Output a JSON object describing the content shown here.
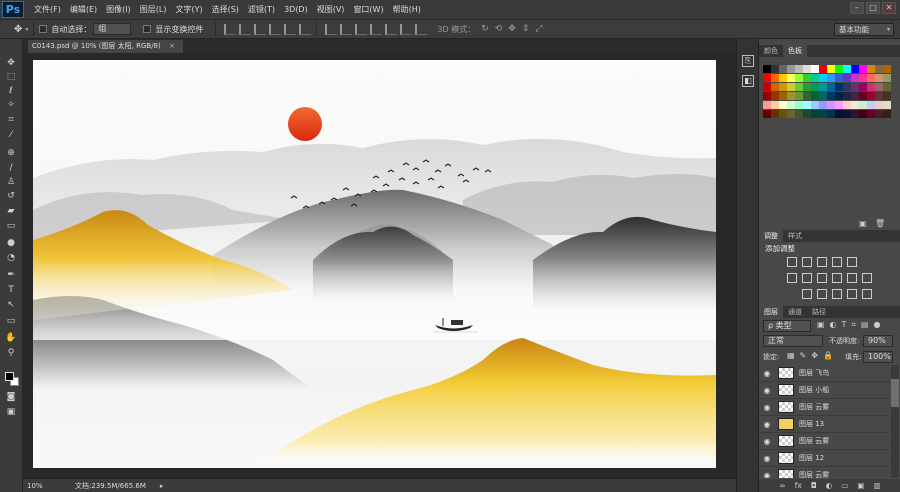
{
  "app": {
    "logo": "Ps"
  },
  "menu": [
    "文件(F)",
    "编辑(E)",
    "图像(I)",
    "图层(L)",
    "文字(Y)",
    "选择(S)",
    "滤镜(T)",
    "3D(D)",
    "视图(V)",
    "窗口(W)",
    "帮助(H)"
  ],
  "window_controls": [
    "–",
    "□",
    "✕"
  ],
  "options": {
    "auto_select_label": "自动选择：",
    "auto_select_value": "组",
    "show_transform_label": "显示变换控件",
    "mode_3d_label": "3D 模式：",
    "workspace": "基本功能"
  },
  "document_tab": {
    "label": "C0143.psd @ 10% (图层 太阳, RGB/8)",
    "close": "×"
  },
  "status": {
    "zoom": "10%",
    "doc_size": "文档:239.5M/665.6M",
    "arrow": "▸"
  },
  "panels": {
    "color": {
      "tabs": [
        "颜色",
        "色板"
      ],
      "active": 1
    },
    "adjustments": {
      "tabs": [
        "调整",
        "样式"
      ],
      "active": 0,
      "title": "添加调整"
    },
    "layers": {
      "tabs": [
        "图层",
        "通道",
        "路径"
      ],
      "active": 0,
      "filter": "ρ 类型",
      "blend_mode": "正常",
      "opacity_label": "不透明度:",
      "opacity_value": "90%",
      "lock_label": "锁定:",
      "fill_label": "填充:",
      "fill_value": "100%",
      "rows": [
        "图层 飞鸟",
        "图层 小船",
        "图层 云雾",
        "图层 13",
        "图层 云雾",
        "图层 12",
        "图层 云雾"
      ],
      "footer_icons": [
        "link-icon",
        "fx-icon",
        "mask-icon",
        "adjustment-icon",
        "folder-icon",
        "new-layer-icon",
        "trash-icon"
      ]
    }
  },
  "colors": {
    "sun": "#e8431c",
    "gold": "#e9b42a",
    "mountain_grey": "#8a8a8a",
    "mountain_dark": "#3d3d3d"
  }
}
